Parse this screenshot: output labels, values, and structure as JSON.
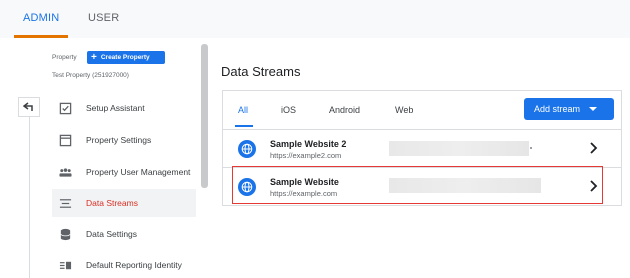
{
  "top_tabs": {
    "admin": "ADMIN",
    "user": "USER"
  },
  "property": {
    "label": "Property",
    "create_button": "Create Property",
    "name": "Test Property (251927000)"
  },
  "menu": [
    {
      "label": "Setup Assistant",
      "icon": "checkbox-icon"
    },
    {
      "label": "Property Settings",
      "icon": "window-icon"
    },
    {
      "label": "Property User Management",
      "icon": "people-icon"
    },
    {
      "label": "Data Streams",
      "icon": "streams-icon",
      "active": true
    },
    {
      "label": "Data Settings",
      "icon": "database-icon"
    },
    {
      "label": "Default Reporting Identity",
      "icon": "identity-icon"
    }
  ],
  "main": {
    "title": "Data Streams",
    "tabs": [
      "All",
      "iOS",
      "Android",
      "Web"
    ],
    "add_stream": "Add stream",
    "streams": [
      {
        "name": "Sample Website 2",
        "url": "https://example2.com"
      },
      {
        "name": "Sample Website",
        "url": "https://example.com"
      }
    ]
  },
  "colors": {
    "accent": "#1a73e8",
    "active_menu": "#d93025",
    "tab_underline": "#e37400",
    "highlight": "#e53935"
  }
}
